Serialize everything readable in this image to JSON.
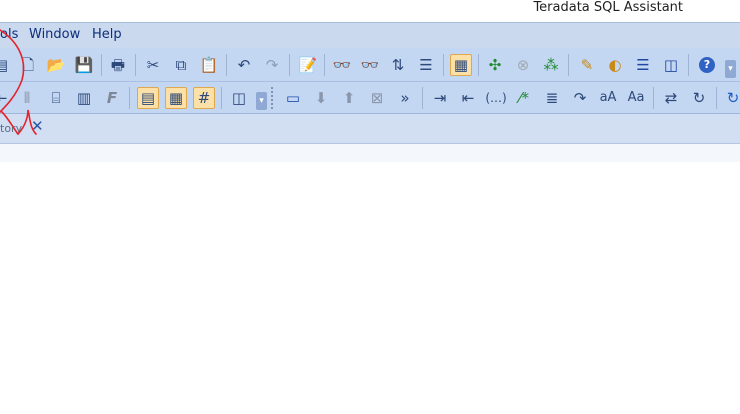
{
  "app": {
    "title": "Teradata SQL Assistant"
  },
  "menu": {
    "items": [
      "ols",
      "Window",
      "Help"
    ]
  },
  "toolbar1": {
    "icons": [
      {
        "name": "properties-icon",
        "glyph": "▤"
      },
      {
        "name": "new-document-icon",
        "glyph": "🗋"
      },
      {
        "name": "open-folder-icon",
        "glyph": "📂"
      },
      {
        "name": "save-icon",
        "glyph": "💾"
      },
      {
        "name": "print-icon",
        "glyph": "🖶"
      },
      {
        "name": "cut-icon",
        "glyph": "✂"
      },
      {
        "name": "copy-icon",
        "glyph": "⧉"
      },
      {
        "name": "paste-icon",
        "glyph": "📋"
      },
      {
        "name": "undo-icon",
        "glyph": "↶"
      },
      {
        "name": "redo-icon",
        "glyph": "↷"
      },
      {
        "name": "edit-note-icon",
        "glyph": "📝"
      },
      {
        "name": "find-icon",
        "glyph": "👓"
      },
      {
        "name": "find-next-icon",
        "glyph": "👓"
      },
      {
        "name": "sort-icon",
        "glyph": "⇅"
      },
      {
        "name": "indent-icon",
        "glyph": "☰"
      },
      {
        "name": "query-builder-icon",
        "glyph": "▦"
      },
      {
        "name": "execute-icon",
        "glyph": "✣"
      },
      {
        "name": "cancel-query-icon",
        "glyph": "⊗"
      },
      {
        "name": "execute-parallel-icon",
        "glyph": "⁂"
      },
      {
        "name": "format-query-icon",
        "glyph": "✎"
      },
      {
        "name": "explain-icon",
        "glyph": "◐"
      },
      {
        "name": "layout-rows-icon",
        "glyph": "☰"
      },
      {
        "name": "layout-columns-icon",
        "glyph": "◫"
      },
      {
        "name": "help-icon",
        "glyph": "?"
      }
    ]
  },
  "toolbar2": {
    "icons": [
      {
        "name": "step-back-icon",
        "glyph": "⇤"
      },
      {
        "name": "grid-lines-icon",
        "glyph": "⫴"
      },
      {
        "name": "fit-columns-icon",
        "glyph": "⌸"
      },
      {
        "name": "column-width-icon",
        "glyph": "▥"
      },
      {
        "name": "format-cells-icon",
        "glyph": "F"
      },
      {
        "name": "grid-view-icon",
        "glyph": "▤"
      },
      {
        "name": "grid-view-alt-icon",
        "glyph": "▦"
      },
      {
        "name": "grid-hash-icon",
        "glyph": "#"
      },
      {
        "name": "split-panes-icon",
        "glyph": "◫"
      },
      {
        "name": "new-window-icon",
        "glyph": "▭"
      },
      {
        "name": "move-down-icon",
        "glyph": "⬇"
      },
      {
        "name": "move-up-icon",
        "glyph": "⬆"
      },
      {
        "name": "delete-icon",
        "glyph": "⊠"
      },
      {
        "name": "next-icon",
        "glyph": "»"
      },
      {
        "name": "indent-more-icon",
        "glyph": "⇥"
      },
      {
        "name": "indent-less-icon",
        "glyph": "⇤"
      },
      {
        "name": "parentheses-icon",
        "glyph": "(…)"
      },
      {
        "name": "comment-icon",
        "glyph": "⁄*"
      },
      {
        "name": "list-icon",
        "glyph": "≣"
      },
      {
        "name": "wrap-icon",
        "glyph": "↷"
      },
      {
        "name": "lowercase-icon",
        "glyph": "aA"
      },
      {
        "name": "capitalize-icon",
        "glyph": "Aa"
      },
      {
        "name": "replace-icon",
        "glyph": "⇄"
      },
      {
        "name": "transform-icon",
        "glyph": "↻"
      },
      {
        "name": "refresh-icon",
        "glyph": "↻"
      }
    ]
  },
  "tab": {
    "label": "tory",
    "close_glyph": "✕"
  },
  "colors": {
    "annotation": "#e5242a",
    "menubar": "#cbd9ef",
    "toolbar": "#c3d6f2"
  }
}
